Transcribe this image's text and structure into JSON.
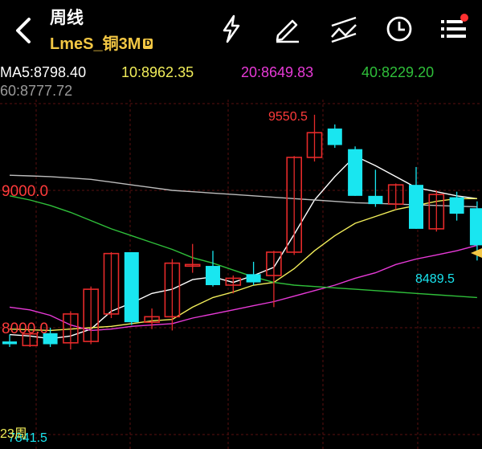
{
  "header": {
    "title": "周线",
    "subtitle": "LmeS_铜3M",
    "badge": "D",
    "icons": [
      "back-icon",
      "lightning-icon",
      "pencil-icon",
      "draw-lines-icon",
      "clock-icon",
      "menu-icon"
    ],
    "notify_dot_color": "#ff3030"
  },
  "ma": {
    "ma5": "MA5:8798.40",
    "ma10": "10:8962.35",
    "ma20": "20:8649.83",
    "ma40": "40:8229.20",
    "ma60": "60:8777.72"
  },
  "chart_labels": {
    "high_label": "9550.5",
    "low_label": "8489.5",
    "y_label_9000": "9000.0",
    "y_label_8000": "8000.0",
    "bottom_label": "23周",
    "bottom_value": "7841.5"
  },
  "colors": {
    "up": "#e62a2a",
    "down": "#19e6f0",
    "ma5": "#ffffff",
    "ma10": "#f2ee5a",
    "ma20": "#e83ad8",
    "ma40": "#2fbf3a",
    "ma60": "#bcbcbc",
    "accent": "#f3c744"
  },
  "chart_data": {
    "type": "candlestick",
    "y_axis_labels": [
      9000.0,
      8000.0
    ],
    "max_price": 9550.5,
    "min_price": 8489.5,
    "candles": [
      {
        "o": 7900,
        "h": 7950,
        "l": 7860,
        "c": 7880
      },
      {
        "o": 7870,
        "h": 7960,
        "l": 7860,
        "c": 7955
      },
      {
        "o": 7960,
        "h": 8000,
        "l": 7860,
        "c": 7880
      },
      {
        "o": 7890,
        "h": 8120,
        "l": 7842,
        "c": 8100
      },
      {
        "o": 7900,
        "h": 8300,
        "l": 7880,
        "c": 8280
      },
      {
        "o": 8100,
        "h": 8550,
        "l": 8070,
        "c": 8540
      },
      {
        "o": 8550,
        "h": 8550,
        "l": 8020,
        "c": 8040
      },
      {
        "o": 8040,
        "h": 8140,
        "l": 7990,
        "c": 8080
      },
      {
        "o": 8080,
        "h": 8500,
        "l": 7980,
        "c": 8470
      },
      {
        "o": 8460,
        "h": 8610,
        "l": 8400,
        "c": 8460
      },
      {
        "o": 8450,
        "h": 8560,
        "l": 8300,
        "c": 8310
      },
      {
        "o": 8310,
        "h": 8380,
        "l": 8250,
        "c": 8360
      },
      {
        "o": 8390,
        "h": 8480,
        "l": 8310,
        "c": 8330
      },
      {
        "o": 8380,
        "h": 8560,
        "l": 8150,
        "c": 8550
      },
      {
        "o": 8550,
        "h": 9250,
        "l": 8530,
        "c": 9240
      },
      {
        "o": 9240,
        "h": 9550.5,
        "l": 9210,
        "c": 9420
      },
      {
        "o": 9450,
        "h": 9480,
        "l": 9310,
        "c": 9330
      },
      {
        "o": 9300,
        "h": 9320,
        "l": 8960,
        "c": 8960
      },
      {
        "o": 8960,
        "h": 9150,
        "l": 8880,
        "c": 8900
      },
      {
        "o": 8900,
        "h": 9050,
        "l": 8860,
        "c": 9040
      },
      {
        "o": 9040,
        "h": 9170,
        "l": 8720,
        "c": 8720
      },
      {
        "o": 8720,
        "h": 9000,
        "l": 8700,
        "c": 8970
      },
      {
        "o": 8950,
        "h": 8990,
        "l": 8780,
        "c": 8830
      },
      {
        "o": 8870,
        "h": 8920,
        "l": 8489.5,
        "c": 8600
      }
    ],
    "series": [
      {
        "name": "MA5",
        "values": [
          7950,
          7940,
          7920,
          7940,
          7990,
          8120,
          8180,
          8250,
          8280,
          8350,
          8370,
          8330,
          8380,
          8440,
          8680,
          8930,
          9100,
          9250,
          9180,
          9100,
          9020,
          8990,
          8960,
          8940
        ]
      },
      {
        "name": "MA10",
        "values": [
          7990,
          7985,
          7980,
          7990,
          8000,
          8010,
          8030,
          8050,
          8060,
          8150,
          8220,
          8260,
          8310,
          8330,
          8430,
          8560,
          8670,
          8760,
          8810,
          8860,
          8890,
          8920,
          8940,
          8940
        ]
      },
      {
        "name": "MA20",
        "values": [
          8150,
          8130,
          8090,
          8020,
          7980,
          7990,
          8010,
          8020,
          8030,
          8070,
          8100,
          8130,
          8160,
          8190,
          8230,
          8270,
          8310,
          8360,
          8400,
          8460,
          8500,
          8530,
          8560,
          8600
        ]
      },
      {
        "name": "MA40",
        "values": [
          8960,
          8930,
          8890,
          8840,
          8780,
          8720,
          8670,
          8620,
          8570,
          8510,
          8470,
          8420,
          8370,
          8330,
          8310,
          8300,
          8290,
          8280,
          8270,
          8260,
          8250,
          8240,
          8230,
          8220
        ]
      },
      {
        "name": "MA60",
        "values": [
          9110,
          9105,
          9100,
          9090,
          9080,
          9060,
          9040,
          9020,
          9000,
          8990,
          8980,
          8970,
          8960,
          8950,
          8940,
          8930,
          8920,
          8910,
          8905,
          8900,
          8895,
          8890,
          8885,
          8880
        ]
      }
    ]
  }
}
